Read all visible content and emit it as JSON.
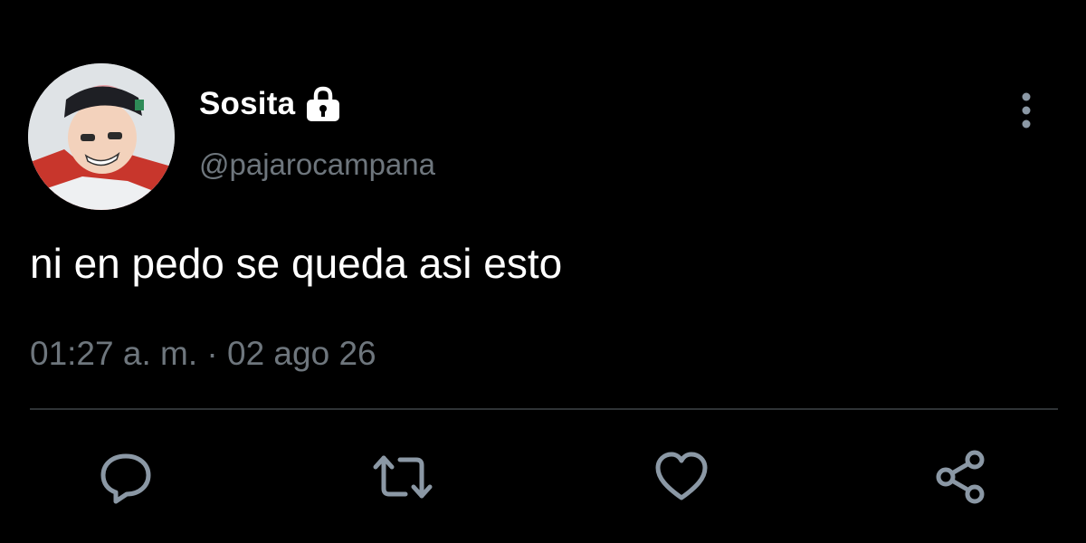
{
  "tweet": {
    "display_name": "Sosita",
    "handle": "@pajarocampana",
    "protected": true,
    "text": "ni en pedo se queda asi esto",
    "time": "01:27 a. m.",
    "separator": "·",
    "date": "02 ago 26"
  },
  "icons": {
    "lock": "lock-icon",
    "more": "more-vertical-icon",
    "reply": "reply-icon",
    "retweet": "retweet-icon",
    "like": "heart-icon",
    "share": "share-icon"
  },
  "colors": {
    "background": "#000000",
    "primary_text": "#ffffff",
    "secondary_text": "#6e767d",
    "divider": "#2f3336",
    "icon": "#8b98a5"
  }
}
